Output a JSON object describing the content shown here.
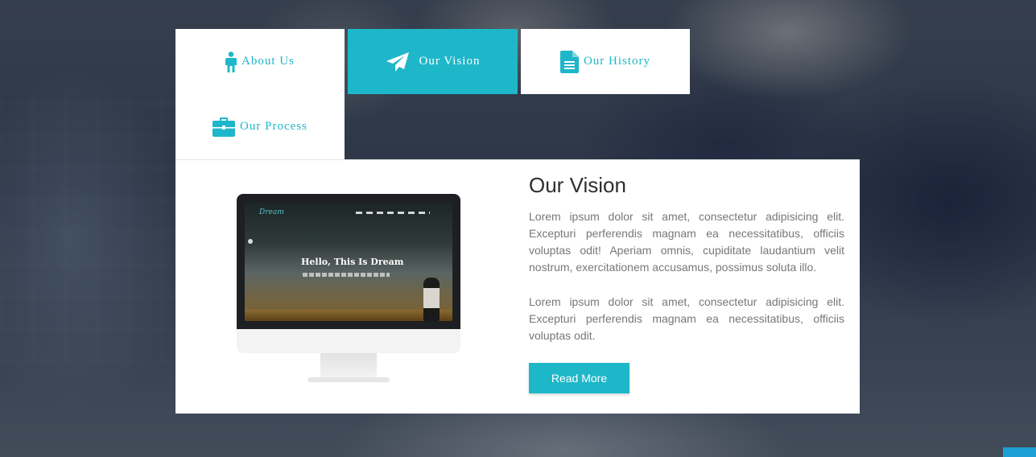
{
  "tabs": [
    {
      "label": "About Us",
      "icon": "person-icon"
    },
    {
      "label": "Our Vision",
      "icon": "paper-plane-icon",
      "active": true
    },
    {
      "label": "Our History",
      "icon": "document-icon"
    },
    {
      "label": "Our Process",
      "icon": "briefcase-icon"
    }
  ],
  "content": {
    "title": "Our Vision",
    "paragraph1": "Lorem ipsum dolor sit amet, consectetur adipisicing elit. Excepturi perferendis magnam ea necessitatibus, officiis voluptas odit! Aperiam omnis, cupiditate laudantium velit nostrum, exercitationem accusamus, possimus soluta illo.",
    "paragraph2": "Lorem ipsum dolor sit amet, consectetur adipisicing elit. Excepturi perferendis magnam ea necessitatibus, officiis voluptas odit.",
    "button_label": "Read More"
  },
  "mockup": {
    "brand": "Dream",
    "headline": "Hello, This Is Dream"
  },
  "colors": {
    "accent": "#1eb7c9",
    "text": "#777777",
    "heading": "#2e2e2e"
  }
}
